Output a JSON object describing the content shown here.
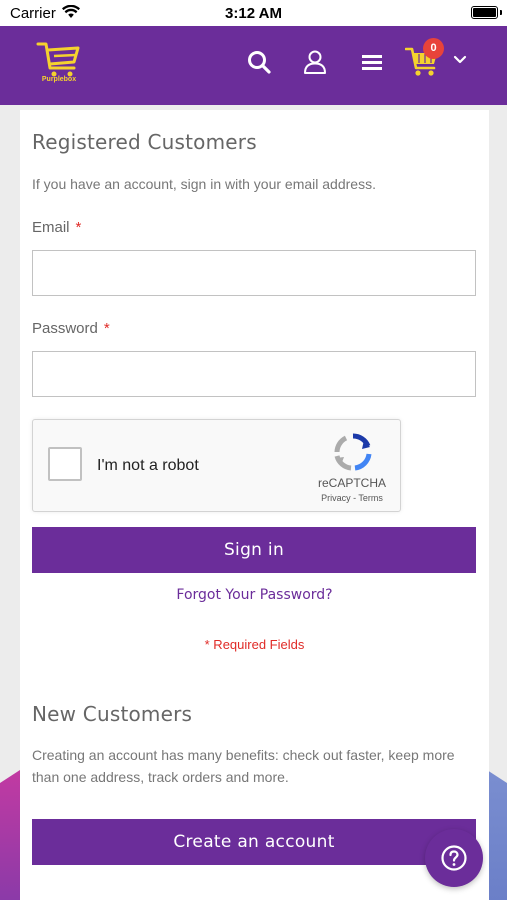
{
  "status_bar": {
    "carrier": "Carrier",
    "time": "3:12 AM"
  },
  "header": {
    "logo_text": "Purplebox",
    "cart_count": "0",
    "icons": [
      "search-icon",
      "account-icon",
      "menu-icon",
      "cart-icon",
      "chevron-down-icon"
    ]
  },
  "registered": {
    "title": "Registered Customers",
    "lead": "If you have an account, sign in with your email address.",
    "email_label": "Email",
    "email_value": "",
    "password_label": "Password",
    "password_value": "",
    "required_mark": "*",
    "recaptcha_label": "I'm not a robot",
    "recaptcha_brand": "reCAPTCHA",
    "recaptcha_links": "Privacy - Terms",
    "signin_label": "Sign in",
    "forgot_label": "Forgot Your Password?",
    "required_note": "* Required Fields"
  },
  "new_customers": {
    "title": "New Customers",
    "lead": "Creating an account has many benefits: check out faster, keep more than one address, track orders and more.",
    "create_label": "Create an account"
  },
  "colors": {
    "brand": "#6b2d9a",
    "required": "#e02b27",
    "badge": "#e8433a",
    "logo": "#f5d22e"
  }
}
